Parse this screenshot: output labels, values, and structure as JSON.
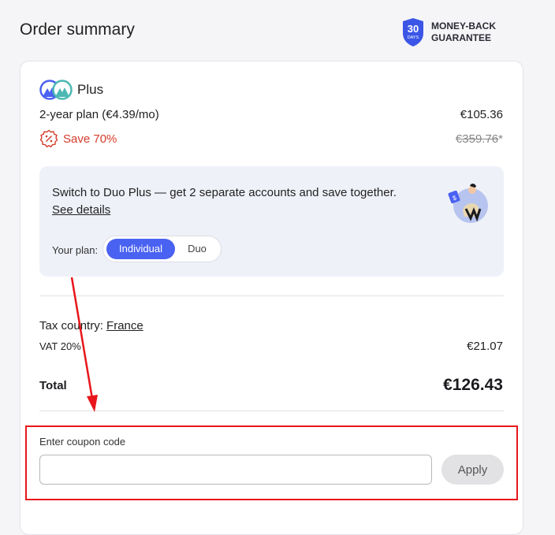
{
  "header": {
    "title": "Order summary",
    "guarantee_days": "30",
    "guarantee_days_label": "DAYS",
    "guarantee_line1": "MONEY-BACK",
    "guarantee_line2": "GUARANTEE"
  },
  "plan": {
    "name": "Plus",
    "term": "2-year plan (€4.39/mo)",
    "price": "€105.36",
    "save_label": "Save 70%",
    "old_price": "€359.76",
    "old_price_marker": "*"
  },
  "duo_offer": {
    "text": "Switch to Duo Plus — get 2 separate accounts and save together.",
    "details_link": "See details",
    "your_plan_label": "Your plan:",
    "options": [
      "Individual",
      "Duo"
    ],
    "selected": "Individual"
  },
  "tax": {
    "label": "Tax country:",
    "country": "France",
    "vat_label": "VAT 20%",
    "vat_amount": "€21.07"
  },
  "total": {
    "label": "Total",
    "amount": "€126.43"
  },
  "coupon": {
    "label": "Enter coupon code",
    "value": "",
    "placeholder": "",
    "apply_label": "Apply"
  },
  "colors": {
    "accent": "#4a62f1",
    "save_red": "#d43b2a",
    "annotation_red": "#e8161b"
  }
}
